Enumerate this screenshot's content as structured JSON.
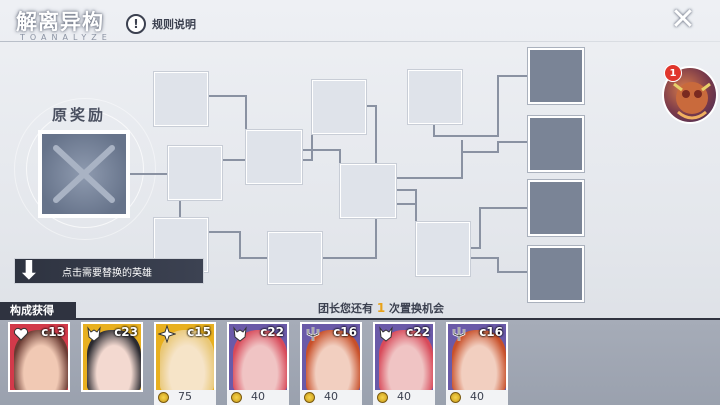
{
  "header": {
    "title": "解离异构",
    "subtitle": "TOANALYZE",
    "rules_label": "规则说明",
    "rules_icon": "exclamation-icon",
    "close_icon": "close-icon"
  },
  "original_reward": {
    "title": "原奖励"
  },
  "avatar": {
    "badge": "1"
  },
  "hint": {
    "label": "点击需要替换的英雄",
    "icon": "down-arrow-icon"
  },
  "bottom": {
    "compose_tab": "构成获得",
    "chances_prefix": "团长您还有",
    "chances_count": "1",
    "chances_suffix": "次置换机会"
  },
  "cards": [
    {
      "cost": "c13",
      "frame": "#d23a4a",
      "face": "#f1c9b4",
      "hair": "#6a3a32",
      "emblem": "heart-icon",
      "price": ""
    },
    {
      "cost": "c23",
      "frame": "#e8b020",
      "face": "#f3d9d0",
      "hair": "#2a2a30",
      "emblem": "demon-icon",
      "price": ""
    },
    {
      "cost": "c15",
      "frame": "#e8b020",
      "face": "#f6e4c8",
      "hair": "#e9c878",
      "emblem": "burst-icon",
      "price": "75"
    },
    {
      "cost": "c22",
      "frame": "#6a5aa8",
      "face": "#f0c4c4",
      "hair": "#d84a5a",
      "emblem": "demon-icon",
      "price": "40"
    },
    {
      "cost": "c16",
      "frame": "#6a5aa8",
      "face": "#f2cfc0",
      "hair": "#c8502a",
      "emblem": "trident-icon",
      "price": "40"
    },
    {
      "cost": "c22",
      "frame": "#6a5aa8",
      "face": "#f0c4c4",
      "hair": "#d84a5a",
      "emblem": "demon-icon",
      "price": "40"
    },
    {
      "cost": "c16",
      "frame": "#6a5aa8",
      "face": "#f2cfc0",
      "hair": "#c8502a",
      "emblem": "trident-icon",
      "price": "40"
    }
  ],
  "colors": {
    "accent_gold": "#e8a21a",
    "badge_red": "#e0362c",
    "panel_dark": "#2f3340"
  }
}
